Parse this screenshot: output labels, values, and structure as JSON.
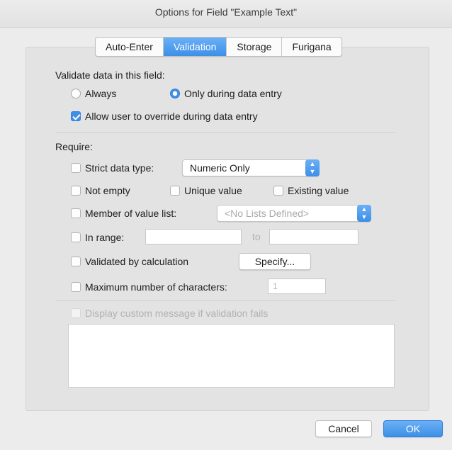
{
  "window": {
    "title": "Options for Field \"Example Text\""
  },
  "tabs": [
    {
      "label": "Auto-Enter",
      "active": false
    },
    {
      "label": "Validation",
      "active": true
    },
    {
      "label": "Storage",
      "active": false
    },
    {
      "label": "Furigana",
      "active": false
    }
  ],
  "validate": {
    "heading": "Validate data in this field:",
    "always_label": "Always",
    "always_selected": false,
    "entry_label": "Only during data entry",
    "entry_selected": true,
    "override_label": "Allow user to override during data entry",
    "override_checked": true
  },
  "require": {
    "heading": "Require:",
    "strict_label": "Strict data type:",
    "strict_checked": false,
    "strict_value": "Numeric Only",
    "not_empty_label": "Not empty",
    "unique_label": "Unique value",
    "existing_label": "Existing value",
    "member_label": "Member of value list:",
    "member_value": "<No Lists Defined>",
    "range_label": "In range:",
    "range_from": "",
    "range_to_label": "to",
    "range_to": "",
    "calc_label": "Validated by calculation",
    "specify_label": "Specify...",
    "max_label": "Maximum number of characters:",
    "max_value": "1",
    "custom_msg_label": "Display custom message if validation fails",
    "custom_msg_text": ""
  },
  "footer": {
    "cancel_label": "Cancel",
    "ok_label": "OK"
  },
  "colors": {
    "accent": "#3d8fe8",
    "window_bg": "#ececec",
    "panel_bg": "#e3e3e3"
  },
  "icons": {
    "select_arrow": "chevron-up-down-icon"
  }
}
